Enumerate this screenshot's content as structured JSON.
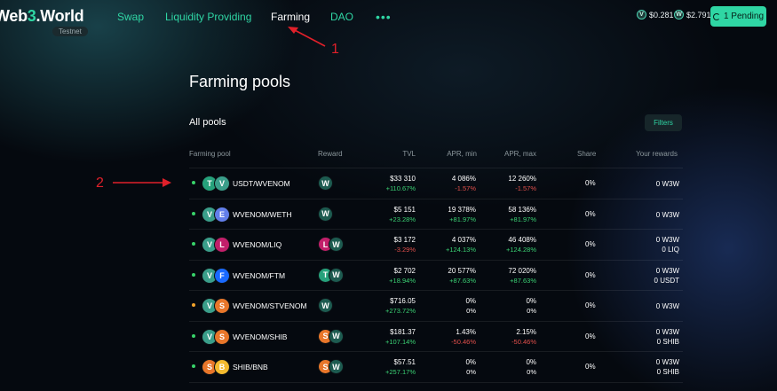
{
  "brand": {
    "name_a": "Web",
    "name_b": "3",
    "name_c": ".World",
    "badge": "Testnet"
  },
  "nav": {
    "items": [
      {
        "label": "Swap",
        "active": false
      },
      {
        "label": "Liquidity Providing",
        "active": false
      },
      {
        "label": "Farming",
        "active": true
      },
      {
        "label": "DAO",
        "active": false
      }
    ],
    "more": "•••"
  },
  "prices": [
    {
      "icon": "venom-token-icon",
      "value": "$0.281"
    },
    {
      "icon": "w3w-token-icon",
      "value": "$2.791"
    }
  ],
  "pending_button": "1 Pending",
  "annotations": {
    "arrow1": "1",
    "arrow2": "2"
  },
  "page_title": "Farming pools",
  "section_title": "All pools",
  "filters_label": "Filters",
  "columns": {
    "pool": "Farming pool",
    "reward": "Reward",
    "tvl": "TVL",
    "apr_min": "APR, min",
    "apr_max": "APR, max",
    "share": "Share",
    "rewards": "Your rewards"
  },
  "rows": [
    {
      "status": "green",
      "pair": "USDT/WVENOM",
      "tokens": [
        "T",
        "V"
      ],
      "reward_tokens": [
        "W"
      ],
      "tvl": "$33 310",
      "tvl_d": "+110.67%",
      "tvl_s": "pos",
      "amin": "4 086%",
      "amin_d": "-1.57%",
      "amin_s": "neg",
      "amax": "12 260%",
      "amax_d": "-1.57%",
      "amax_s": "neg",
      "share": "0%",
      "rewards": [
        "0 W3W"
      ]
    },
    {
      "status": "green",
      "pair": "WVENOM/WETH",
      "tokens": [
        "V",
        "E"
      ],
      "reward_tokens": [
        "W"
      ],
      "tvl": "$5 151",
      "tvl_d": "+23.28%",
      "tvl_s": "pos",
      "amin": "19 378%",
      "amin_d": "+81.97%",
      "amin_s": "pos",
      "amax": "58 136%",
      "amax_d": "+81.97%",
      "amax_s": "pos",
      "share": "0%",
      "rewards": [
        "0 W3W"
      ]
    },
    {
      "status": "green",
      "pair": "WVENOM/LIQ",
      "tokens": [
        "V",
        "L"
      ],
      "reward_tokens": [
        "L",
        "W"
      ],
      "tvl": "$3 172",
      "tvl_d": "-3.29%",
      "tvl_s": "neg",
      "amin": "4 037%",
      "amin_d": "+124.13%",
      "amin_s": "pos",
      "amax": "46 408%",
      "amax_d": "+124.28%",
      "amax_s": "pos",
      "share": "0%",
      "rewards": [
        "0 W3W",
        "0 LIQ"
      ]
    },
    {
      "status": "green",
      "pair": "WVENOM/FTM",
      "tokens": [
        "V",
        "F"
      ],
      "reward_tokens": [
        "T",
        "W"
      ],
      "tvl": "$2 702",
      "tvl_d": "+18.94%",
      "tvl_s": "pos",
      "amin": "20 577%",
      "amin_d": "+87.63%",
      "amin_s": "pos",
      "amax": "72 020%",
      "amax_d": "+87.63%",
      "amax_s": "pos",
      "share": "0%",
      "rewards": [
        "0 W3W",
        "0 USDT"
      ]
    },
    {
      "status": "orange",
      "pair": "WVENOM/STVENOM",
      "tokens": [
        "V",
        "S"
      ],
      "reward_tokens": [
        "W"
      ],
      "tvl": "$716.05",
      "tvl_d": "+273.72%",
      "tvl_s": "pos",
      "amin": "0%",
      "amin_d": "0%",
      "amin_s": "plain",
      "amax": "0%",
      "amax_d": "0%",
      "amax_s": "plain",
      "share": "0%",
      "rewards": [
        "0 W3W"
      ]
    },
    {
      "status": "green",
      "pair": "WVENOM/SHIB",
      "tokens": [
        "V",
        "S"
      ],
      "reward_tokens": [
        "S",
        "W"
      ],
      "tvl": "$181.37",
      "tvl_d": "+107.14%",
      "tvl_s": "pos",
      "amin": "1.43%",
      "amin_d": "-50.46%",
      "amin_s": "neg",
      "amax": "2.15%",
      "amax_d": "-50.46%",
      "amax_s": "neg",
      "share": "0%",
      "rewards": [
        "0 W3W",
        "0 SHIB"
      ]
    },
    {
      "status": "green",
      "pair": "SHIB/BNB",
      "tokens": [
        "S",
        "B"
      ],
      "reward_tokens": [
        "S",
        "W"
      ],
      "tvl": "$57.51",
      "tvl_d": "+257.17%",
      "tvl_s": "pos",
      "amin": "0%",
      "amin_d": "0%",
      "amin_s": "plain",
      "amax": "0%",
      "amax_d": "0%",
      "amax_s": "plain",
      "share": "0%",
      "rewards": [
        "0 W3W",
        "0 SHIB"
      ]
    }
  ],
  "colors": {
    "accent": "#2fd6a4",
    "positive": "#3bd274",
    "negative": "#e2504c",
    "annotation": "#e0202a"
  }
}
